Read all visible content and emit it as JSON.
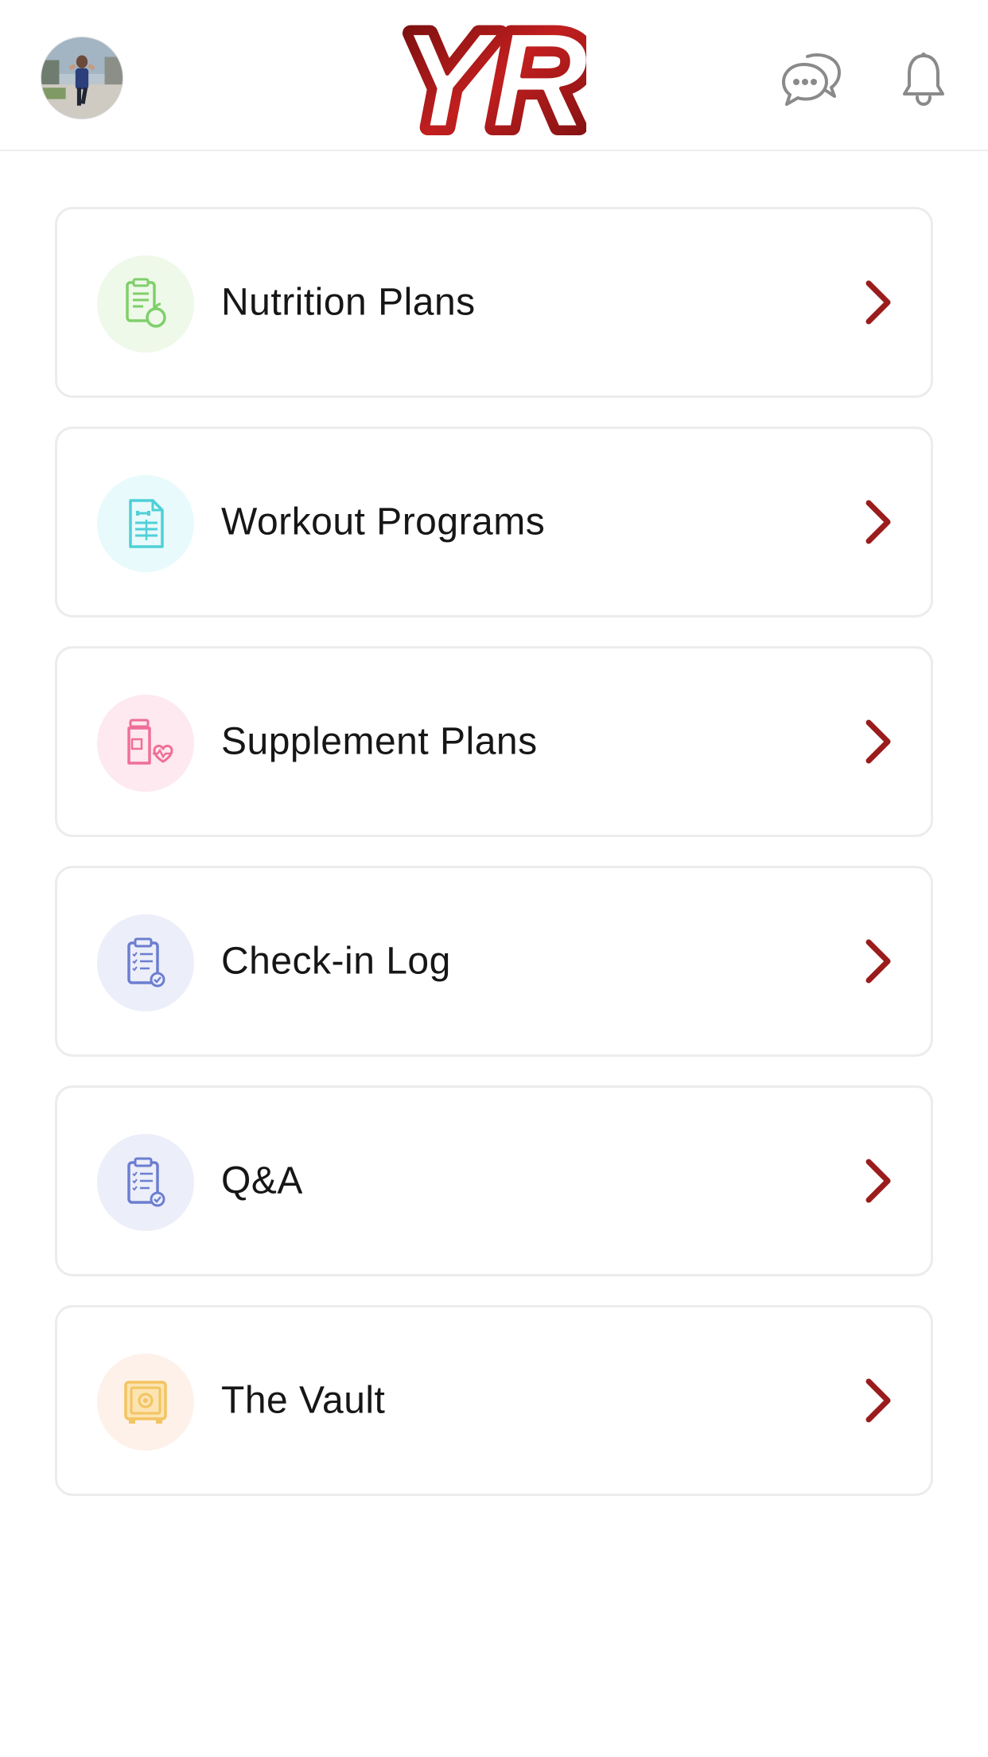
{
  "header": {
    "avatar": "user-avatar",
    "logo_text": "YR",
    "icons": [
      "chat-bubbles-icon",
      "bell-icon"
    ]
  },
  "menu": [
    {
      "label": "Nutrition Plans",
      "icon": "nutrition-clipboard-apple-icon",
      "bg": "#eef9e9",
      "color": "#7fcf6a"
    },
    {
      "label": "Workout Programs",
      "icon": "workout-document-icon",
      "bg": "#e8fafb",
      "color": "#4fd0d8"
    },
    {
      "label": "Supplement Plans",
      "icon": "supplement-bottle-heart-icon",
      "bg": "#fde9ef",
      "color": "#ef6f98"
    },
    {
      "label": "Check-in Log",
      "icon": "checklist-clipboard-icon",
      "bg": "#eceef9",
      "color": "#6c7ed0"
    },
    {
      "label": "Q&A",
      "icon": "checklist-clipboard-icon",
      "bg": "#eceef9",
      "color": "#6c7ed0"
    },
    {
      "label": "The Vault",
      "icon": "vault-safe-icon",
      "bg": "#fdf1ea",
      "color": "#f3c460"
    }
  ],
  "colors": {
    "accent": "#9b1c1c",
    "card_border": "#ececec",
    "icon_gray": "#8a8a8a"
  }
}
